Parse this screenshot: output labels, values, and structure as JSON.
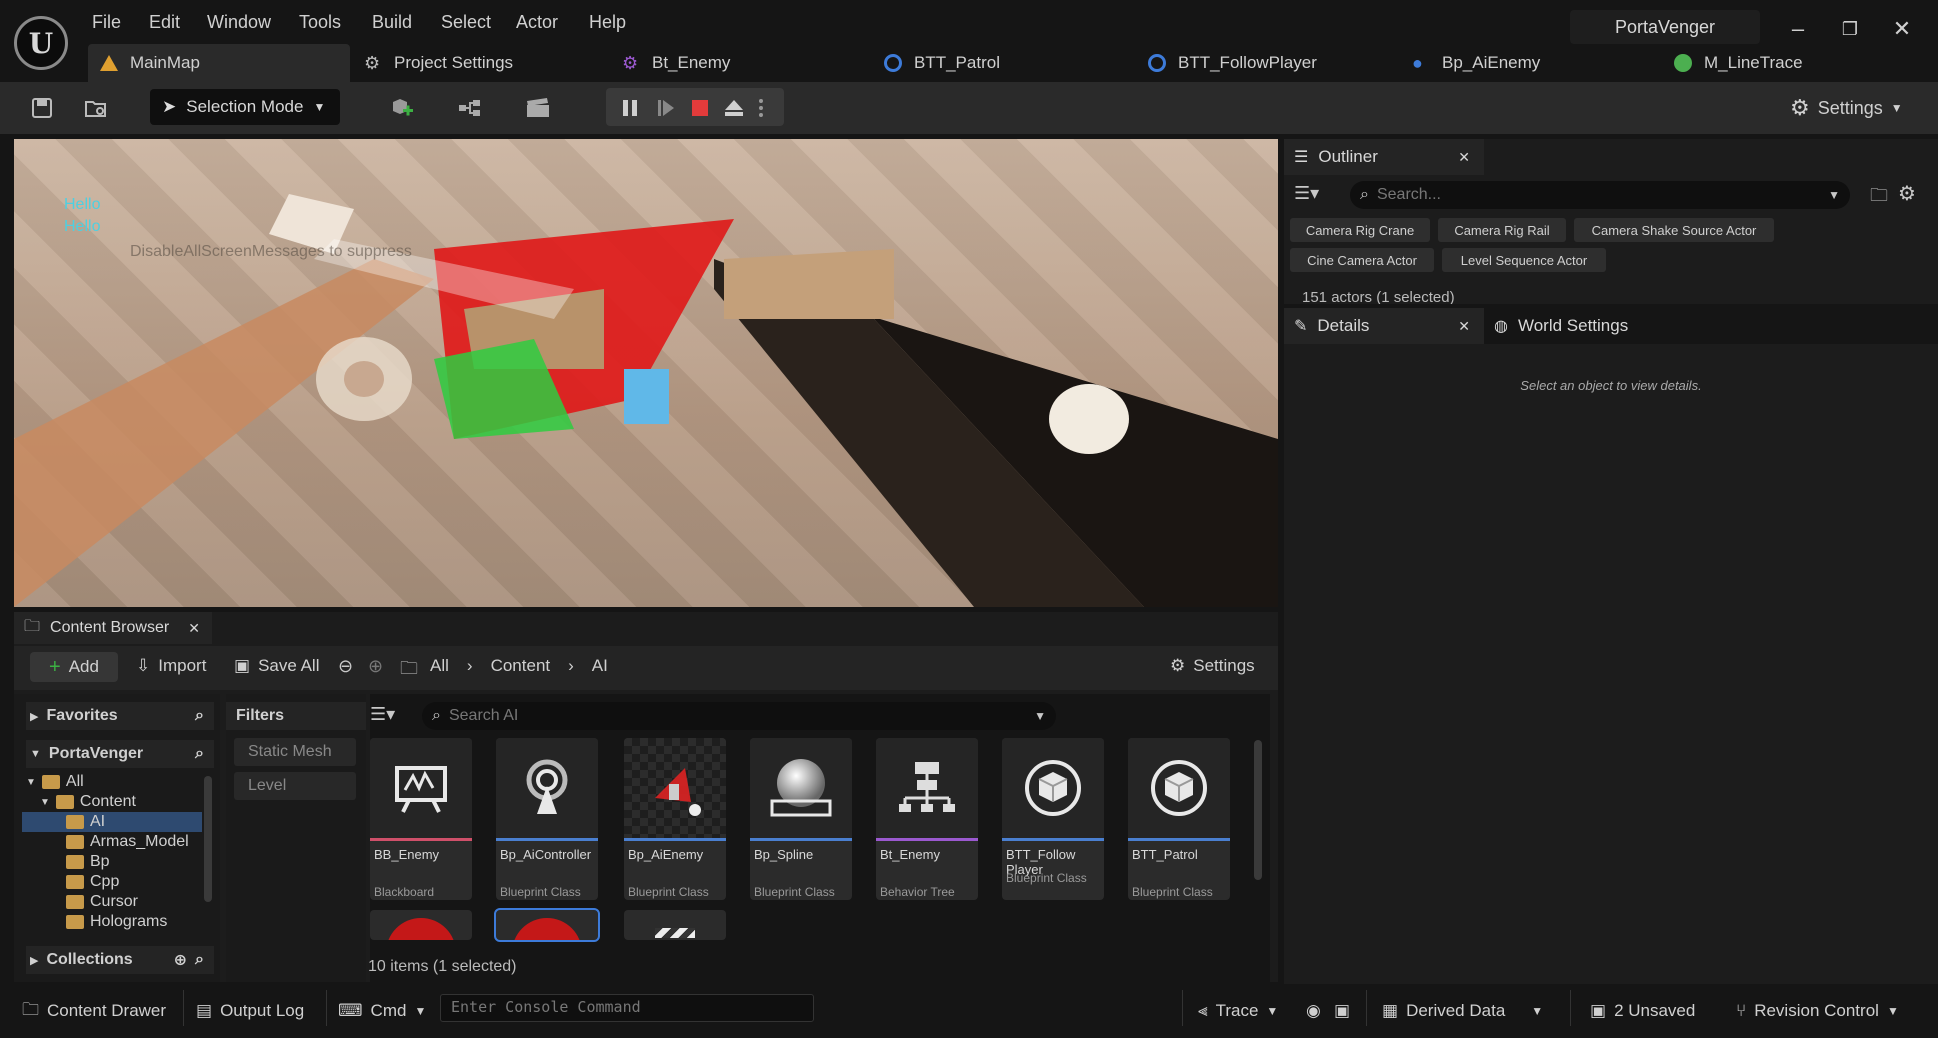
{
  "app": {
    "project_name": "PortaVenger",
    "logo_glyph": "U",
    "menu": [
      "File",
      "Edit",
      "Window",
      "Tools",
      "Build",
      "Select",
      "Actor",
      "Help"
    ]
  },
  "window_controls": {
    "minimize": "–",
    "restore": "❐",
    "close": "✕"
  },
  "tabs": [
    {
      "label": "MainMap",
      "icon": "level-icon",
      "color": "#e0a030"
    },
    {
      "label": "Project Settings",
      "icon": "settings-icon",
      "color": "#bbbbbb"
    },
    {
      "label": "Bt_Enemy",
      "icon": "behavior-tree-icon",
      "color": "#9b59d0"
    },
    {
      "label": "BTT_Patrol",
      "icon": "blueprint-icon",
      "color": "#3d7bd9"
    },
    {
      "label": "BTT_FollowPlayer",
      "icon": "blueprint-icon",
      "color": "#3d7bd9"
    },
    {
      "label": "Bp_AiEnemy",
      "icon": "pawn-icon",
      "color": "#3d7bd9"
    },
    {
      "label": "M_LineTrace",
      "icon": "material-icon",
      "color": "#4caf50"
    }
  ],
  "toolbar": {
    "selection_mode": "Selection Mode",
    "settings": "Settings"
  },
  "viewport": {
    "messages": [
      "Hello",
      "Hello"
    ],
    "overlay_text": "DisableAllScreenMessages to suppress"
  },
  "outliner": {
    "title": "Outliner",
    "search_placeholder": "Search...",
    "chips": [
      "Camera Rig Crane",
      "Camera Rig Rail",
      "Camera Shake Source Actor",
      "Cine Camera Actor",
      "Level Sequence Actor"
    ],
    "status": "151 actors (1 selected)"
  },
  "details": {
    "tab_details": "Details",
    "tab_world_settings": "World Settings",
    "empty_text": "Select an object to view details."
  },
  "content_browser": {
    "title": "Content Browser",
    "add": "Add",
    "import": "Import",
    "save_all": "Save All",
    "breadcrumb": [
      "All",
      "Content",
      "AI"
    ],
    "settings": "Settings",
    "favorites": "Favorites",
    "project": "PortaVenger",
    "filters": "Filters",
    "filter_chips": [
      "Static Mesh",
      "Level"
    ],
    "search_placeholder": "Search AI",
    "tree": [
      {
        "label": "All",
        "depth": 0,
        "open": true
      },
      {
        "label": "Content",
        "depth": 1,
        "open": true
      },
      {
        "label": "AI",
        "depth": 2,
        "selected": true
      },
      {
        "label": "Armas_Model",
        "depth": 2
      },
      {
        "label": "Bp",
        "depth": 2
      },
      {
        "label": "Cpp",
        "depth": 2
      },
      {
        "label": "Cursor",
        "depth": 2
      },
      {
        "label": "Holograms",
        "depth": 2
      }
    ],
    "collections": "Collections",
    "assets": [
      {
        "name": "BB_Enemy",
        "class": "Blackboard",
        "icon": "blackboard-icon",
        "accent": "#d0506a"
      },
      {
        "name": "Bp_AiController",
        "class": "Blueprint Class",
        "icon": "ai-controller-icon",
        "accent": "#4a7fd0"
      },
      {
        "name": "Bp_AiEnemy",
        "class": "Blueprint Class",
        "icon": "enemy-thumbnail-icon",
        "accent": "#4a7fd0"
      },
      {
        "name": "Bp_Spline",
        "class": "Blueprint Class",
        "icon": "sphere-icon",
        "accent": "#4a7fd0"
      },
      {
        "name": "Bt_Enemy",
        "class": "Behavior Tree",
        "icon": "behavior-tree-icon",
        "accent": "#9b59d0"
      },
      {
        "name": "BTT_Follow Player",
        "class": "Blueprint Class",
        "icon": "cube-icon",
        "accent": "#4a7fd0"
      },
      {
        "name": "BTT_Patrol",
        "class": "Blueprint Class",
        "icon": "cube-icon",
        "accent": "#4a7fd0"
      }
    ],
    "status": "10 items (1 selected)"
  },
  "statusbar": {
    "content_drawer": "Content Drawer",
    "output_log": "Output Log",
    "cmd": "Cmd",
    "console_placeholder": "Enter Console Command",
    "trace": "Trace",
    "derived_data": "Derived Data",
    "unsaved": "2 Unsaved",
    "revision_control": "Revision Control"
  }
}
